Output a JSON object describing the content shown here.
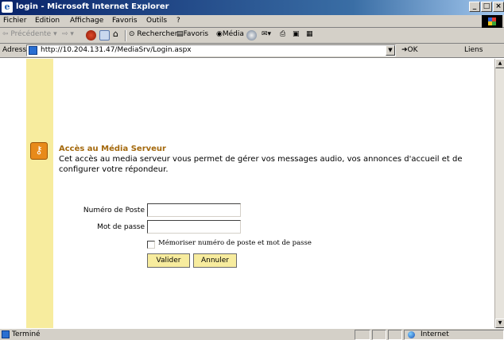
{
  "window": {
    "title": "login - Microsoft Internet Explorer",
    "controls": [
      "_",
      "□",
      "×"
    ]
  },
  "menu": [
    "Fichier",
    "Edition",
    "Affichage",
    "Favoris",
    "Outils",
    "?"
  ],
  "toolbar": {
    "back": "Précédente",
    "search": "Rechercher",
    "favorites": "Favoris",
    "media": "Média"
  },
  "address": {
    "label": "Adresse",
    "url": "http://10.204.131.47/MediaSrv/Login.aspx",
    "go": "OK",
    "links": "Liens"
  },
  "login": {
    "title": "Accès au Média Serveur",
    "description": "Cet accès au media serveur vous permet de gérer vos messages audio, vos annonces d'accueil et de configurer votre répondeur.",
    "extension_label": "Numéro de Poste",
    "extension_value": "",
    "password_label": "Mot de passe",
    "password_value": "",
    "remember_label": "Mémoriser numéro de poste et mot de passe",
    "remember_checked": false,
    "submit": "Valider",
    "cancel": "Annuler"
  },
  "status": {
    "text": "Terminé",
    "zone": "Internet"
  },
  "colors": {
    "title_bar": "#0a246a",
    "accent_yellow": "#f7ec9e",
    "heading": "#a4690d",
    "icon_orange": "#e88a1a"
  },
  "icons": [
    "ie-icon",
    "back-arrow-icon",
    "forward-arrow-icon",
    "stop-icon",
    "refresh-icon",
    "home-icon",
    "search-icon",
    "favorites-icon",
    "media-icon",
    "history-icon",
    "mail-icon",
    "print-icon",
    "edit-icon",
    "key-icon",
    "globe-icon"
  ]
}
